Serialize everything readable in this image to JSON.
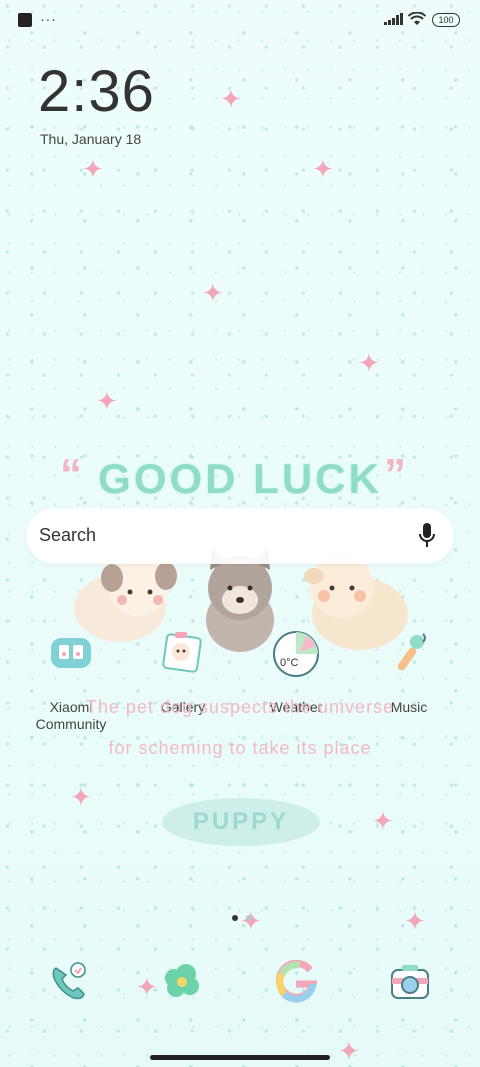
{
  "status": {
    "overflow": "···",
    "battery": "100"
  },
  "lock": {
    "time": "2:36",
    "date": "Thu, January 18"
  },
  "wallpaper": {
    "title": "GOOD LUCK",
    "quote_open": "“",
    "quote_close": "”",
    "line1": "The pet dog suspects the universe",
    "line2": "for scheming to take its place",
    "badge": "PUPPY"
  },
  "search": {
    "placeholder": "Search"
  },
  "apps": [
    {
      "label": "Xiaomi Community"
    },
    {
      "label": "Gallery"
    },
    {
      "label": "Weather",
      "badge": "0°C"
    },
    {
      "label": "Music"
    }
  ],
  "colors": {
    "accent_pink": "#f2a6b8",
    "accent_mint": "#8fdcc8",
    "background": "#eafcfb"
  },
  "pager": {
    "current": 1,
    "total": 2
  }
}
